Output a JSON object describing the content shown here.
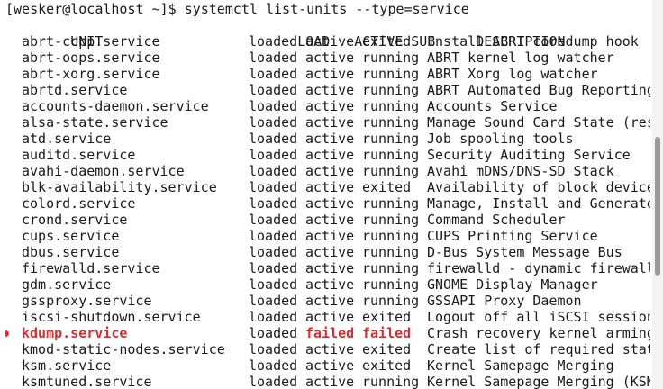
{
  "prompt": "[wesker@localhost ~]$ systemctl list-units --type=service",
  "headers": {
    "unit": "UNIT",
    "load": "LOAD",
    "active": "ACTIVE",
    "sub": "SUB",
    "desc": "DESCRIPTION"
  },
  "rows": [
    {
      "unit": "abrt-ccpp.service",
      "load": "loaded",
      "active": "active",
      "sub": "exited",
      "desc": "Install ABRT coredump hook"
    },
    {
      "unit": "abrt-oops.service",
      "load": "loaded",
      "active": "active",
      "sub": "running",
      "desc": "ABRT kernel log watcher"
    },
    {
      "unit": "abrt-xorg.service",
      "load": "loaded",
      "active": "active",
      "sub": "running",
      "desc": "ABRT Xorg log watcher"
    },
    {
      "unit": "abrtd.service",
      "load": "loaded",
      "active": "active",
      "sub": "running",
      "desc": "ABRT Automated Bug Reporting"
    },
    {
      "unit": "accounts-daemon.service",
      "load": "loaded",
      "active": "active",
      "sub": "running",
      "desc": "Accounts Service"
    },
    {
      "unit": "alsa-state.service",
      "load": "loaded",
      "active": "active",
      "sub": "running",
      "desc": "Manage Sound Card State (res"
    },
    {
      "unit": "atd.service",
      "load": "loaded",
      "active": "active",
      "sub": "running",
      "desc": "Job spooling tools"
    },
    {
      "unit": "auditd.service",
      "load": "loaded",
      "active": "active",
      "sub": "running",
      "desc": "Security Auditing Service"
    },
    {
      "unit": "avahi-daemon.service",
      "load": "loaded",
      "active": "active",
      "sub": "running",
      "desc": "Avahi mDNS/DNS-SD Stack"
    },
    {
      "unit": "blk-availability.service",
      "load": "loaded",
      "active": "active",
      "sub": "exited",
      "desc": "Availability of block device"
    },
    {
      "unit": "colord.service",
      "load": "loaded",
      "active": "active",
      "sub": "running",
      "desc": "Manage, Install and Generate"
    },
    {
      "unit": "crond.service",
      "load": "loaded",
      "active": "active",
      "sub": "running",
      "desc": "Command Scheduler"
    },
    {
      "unit": "cups.service",
      "load": "loaded",
      "active": "active",
      "sub": "running",
      "desc": "CUPS Printing Service"
    },
    {
      "unit": "dbus.service",
      "load": "loaded",
      "active": "active",
      "sub": "running",
      "desc": "D-Bus System Message Bus"
    },
    {
      "unit": "firewalld.service",
      "load": "loaded",
      "active": "active",
      "sub": "running",
      "desc": "firewalld - dynamic firewall"
    },
    {
      "unit": "gdm.service",
      "load": "loaded",
      "active": "active",
      "sub": "running",
      "desc": "GNOME Display Manager"
    },
    {
      "unit": "gssproxy.service",
      "load": "loaded",
      "active": "active",
      "sub": "running",
      "desc": "GSSAPI Proxy Daemon"
    },
    {
      "unit": "iscsi-shutdown.service",
      "load": "loaded",
      "active": "active",
      "sub": "exited",
      "desc": "Logout off all iSCSI session"
    },
    {
      "unit": "kdump.service",
      "load": "loaded",
      "active": "failed",
      "sub": "failed",
      "desc": "Crash recovery kernel arming",
      "failed": true
    },
    {
      "unit": "kmod-static-nodes.service",
      "load": "loaded",
      "active": "active",
      "sub": "exited",
      "desc": "Create list of required stat"
    },
    {
      "unit": "ksm.service",
      "load": "loaded",
      "active": "active",
      "sub": "exited",
      "desc": "Kernel Samepage Merging"
    },
    {
      "unit": "ksmtuned.service",
      "load": "loaded",
      "active": "active",
      "sub": "running",
      "desc": "Kernel Samepage Merging (KSM"
    }
  ],
  "colors": {
    "failed": "#d72f2f",
    "background": "#ffffff",
    "text": "#1a1a1a"
  }
}
